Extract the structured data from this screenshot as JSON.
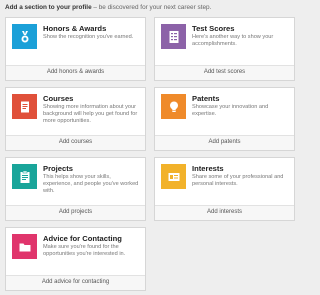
{
  "header": {
    "lead": "Add a section to your profile",
    "sub": " – be discovered for your next career step."
  },
  "cards": [
    {
      "title": "Honors & Awards",
      "desc": "Show the recognition you've earned.",
      "action": "Add honors & awards",
      "color": "#1ba0d8",
      "icon": "award-medal-icon"
    },
    {
      "title": "Test Scores",
      "desc": "Here's another way to show your accomplishments.",
      "action": "Add test scores",
      "color": "#8c62a8",
      "icon": "test-scores-icon"
    },
    {
      "title": "Courses",
      "desc": "Showing more information about your background will help you get found for more opportunities.",
      "action": "Add courses",
      "color": "#e0503a",
      "icon": "courses-book-icon"
    },
    {
      "title": "Patents",
      "desc": "Showcase your innovation and expertise.",
      "action": "Add patents",
      "color": "#ef8a2a",
      "icon": "patent-lightbulb-icon"
    },
    {
      "title": "Projects",
      "desc": "This helps show your skills, experience, and people you've worked with.",
      "action": "Add projects",
      "color": "#19a59a",
      "icon": "projects-clipboard-icon"
    },
    {
      "title": "Interests",
      "desc": "Share some of your professional and personal interests.",
      "action": "Add interests",
      "color": "#f2b22a",
      "icon": "interests-card-icon"
    },
    {
      "title": "Advice for Contacting",
      "desc": "Make sure you're found for the opportunities you're interested in.",
      "action": "Add advice for contacting",
      "color": "#e0356c",
      "icon": "advice-folder-icon"
    }
  ]
}
